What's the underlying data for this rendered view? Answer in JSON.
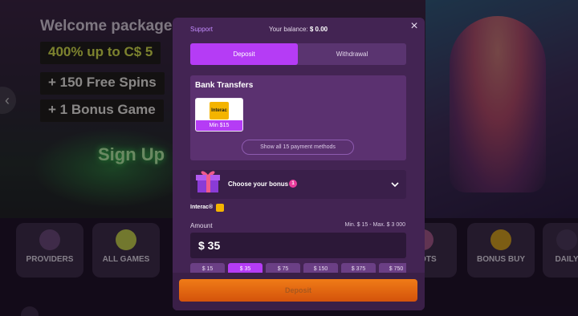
{
  "background": {
    "hero_title": "Welcome package",
    "promo_lines": [
      "400% up to C$ 5",
      "+ 150 Free Spins",
      "+ 1 Bonus Game"
    ],
    "signup_text": "Sign Up",
    "categories": [
      "PROVIDERS",
      "ALL GAMES",
      "SLOTS",
      "BONUS BUY",
      "DAILY"
    ]
  },
  "modal": {
    "support_label": "Support",
    "balance_label": "Your balance:",
    "balance_value": "$ 0.00",
    "tabs": [
      "Deposit",
      "Withdrawal"
    ],
    "active_tab": "Deposit",
    "methods_section": {
      "title": "Bank Transfers",
      "method_logo": "Interac",
      "method_min": "Min $15",
      "show_all": "Show all 15 payment methods"
    },
    "bonus": {
      "label": "Choose your bonus",
      "count": "1"
    },
    "selected_method": "Interac®",
    "amount": {
      "label": "Amount",
      "range": "Min. $ 15 - Max. $ 3 000",
      "value": "$ 35"
    },
    "quick_amounts": [
      "$ 15",
      "$ 35",
      "$ 75",
      "$ 150",
      "$ 375",
      "$ 750"
    ],
    "deposit_button": "Deposit"
  },
  "colors": {
    "accent": "#b53cf5",
    "modal_bg": "#432453",
    "deposit_btn": "#e06612"
  }
}
